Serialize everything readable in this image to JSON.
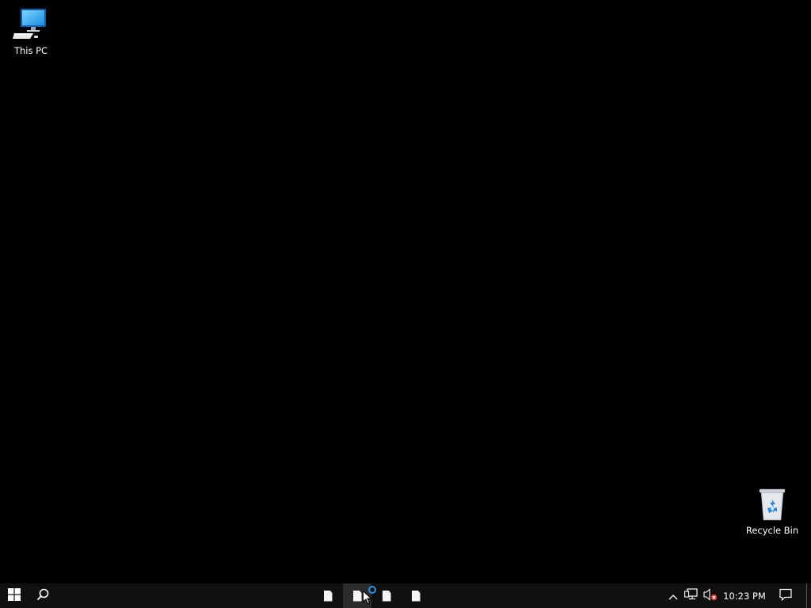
{
  "desktop": {
    "background_color": "#000000",
    "icons": [
      {
        "label": "This PC",
        "icon": "computer-icon"
      },
      {
        "label": "Recycle Bin",
        "icon": "recycle-bin-icon"
      }
    ]
  },
  "taskbar": {
    "background_color": "#101010",
    "start_icon": "windows-logo-icon",
    "search_icon": "search-icon",
    "apps": [
      {
        "icon": "blank-page-icon",
        "active": false
      },
      {
        "icon": "blank-page-icon",
        "active": true,
        "loading": true
      },
      {
        "icon": "blank-page-icon",
        "active": false
      },
      {
        "icon": "blank-page-icon",
        "active": false
      }
    ],
    "tray": {
      "chevron_icon": "chevron-up-icon",
      "network_icon": "network-icon",
      "volume_icon": "volume-muted-icon",
      "clock": "10:23 PM",
      "notification_icon": "action-center-icon"
    }
  }
}
